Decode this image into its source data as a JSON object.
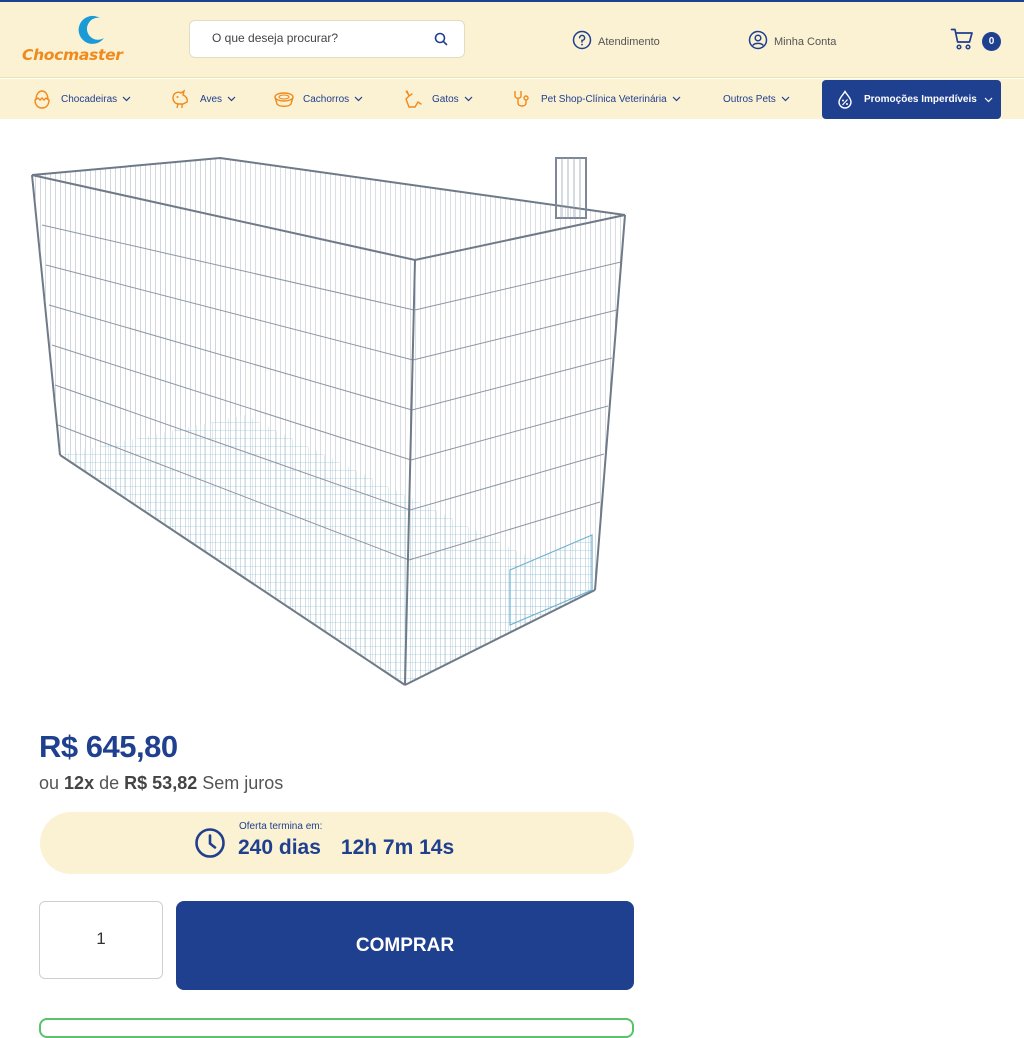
{
  "brand": {
    "logo_text": "Chocmaster",
    "accent": "#1f3f8f",
    "logo_color": "#f08a1c",
    "bar_bg": "#fbf1d3"
  },
  "search": {
    "placeholder": "O que deseja procurar?",
    "value": ""
  },
  "header": {
    "atendimento": "Atendimento",
    "minha_conta": "Minha Conta",
    "cart_count": "0"
  },
  "nav": {
    "items": [
      {
        "label": "Chocadeiras",
        "icon": "egg-hatch-icon"
      },
      {
        "label": "Aves",
        "icon": "bird-icon"
      },
      {
        "label": "Cachorros",
        "icon": "dog-bowl-icon"
      },
      {
        "label": "Gatos",
        "icon": "cat-icon"
      },
      {
        "label": "Pet Shop-Clínica Veterinária",
        "icon": "stethoscope-icon"
      },
      {
        "label": "Outros Pets",
        "icon": ""
      }
    ],
    "promo": "Promoções Imperdíveis"
  },
  "product": {
    "image": "wire-cage-icon",
    "price": "R$ 645,80",
    "installments_prefix": "ou",
    "installments_count": "12x",
    "installments_mid": "de",
    "installment_value": "R$ 53,82",
    "installments_suffix": "Sem juros",
    "offer_label": "Oferta termina em:",
    "offer_days": "240 dias",
    "offer_time": "12h 7m 14s",
    "quantity": "1",
    "buy_label": "COMPRAR"
  }
}
